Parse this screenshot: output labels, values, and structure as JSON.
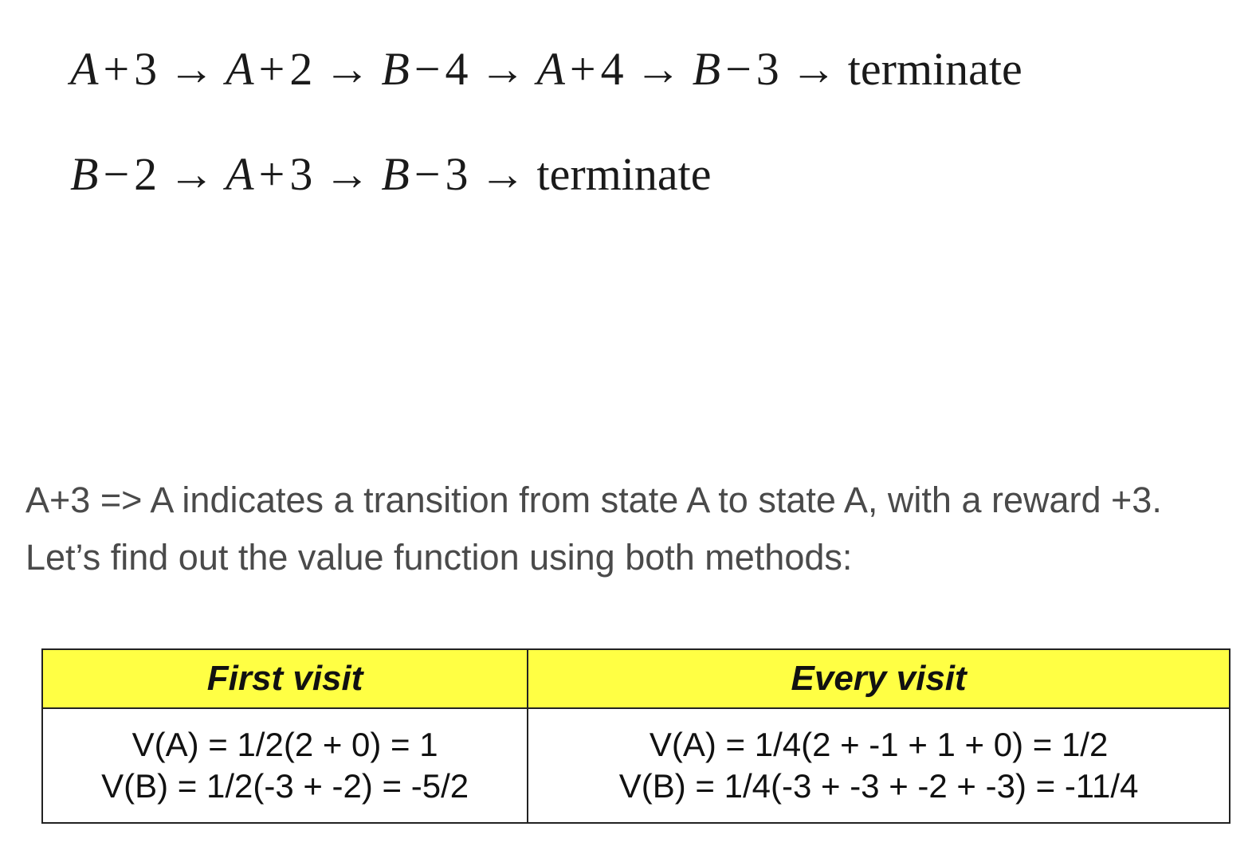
{
  "episodes": [
    {
      "steps": [
        {
          "state": "A",
          "sign": "+",
          "reward": "3"
        },
        {
          "state": "A",
          "sign": "+",
          "reward": "2"
        },
        {
          "state": "B",
          "sign": "−",
          "reward": "4"
        },
        {
          "state": "A",
          "sign": "+",
          "reward": "4"
        },
        {
          "state": "B",
          "sign": "−",
          "reward": "3"
        }
      ],
      "end": "terminate"
    },
    {
      "steps": [
        {
          "state": "B",
          "sign": "−",
          "reward": "2"
        },
        {
          "state": "A",
          "sign": "+",
          "reward": "3"
        },
        {
          "state": "B",
          "sign": "−",
          "reward": "3"
        }
      ],
      "end": "terminate"
    }
  ],
  "arrow_glyph": "→",
  "paragraph": "A+3 => A indicates a transition from state A to state A, with a reward +3. Let’s find out the value function using both methods:",
  "table": {
    "headers": [
      "First visit",
      "Every visit"
    ],
    "first_visit": [
      "V(A) = 1/2(2 + 0) = 1",
      "V(B) = 1/2(-3 + -2) = -5/2"
    ],
    "every_visit": [
      "V(A) = 1/4(2 + -1 + 1 + 0) = 1/2",
      "V(B) = 1/4(-3 + -3 + -2 + -3) = -11/4"
    ],
    "header_color": "#ffff44"
  }
}
